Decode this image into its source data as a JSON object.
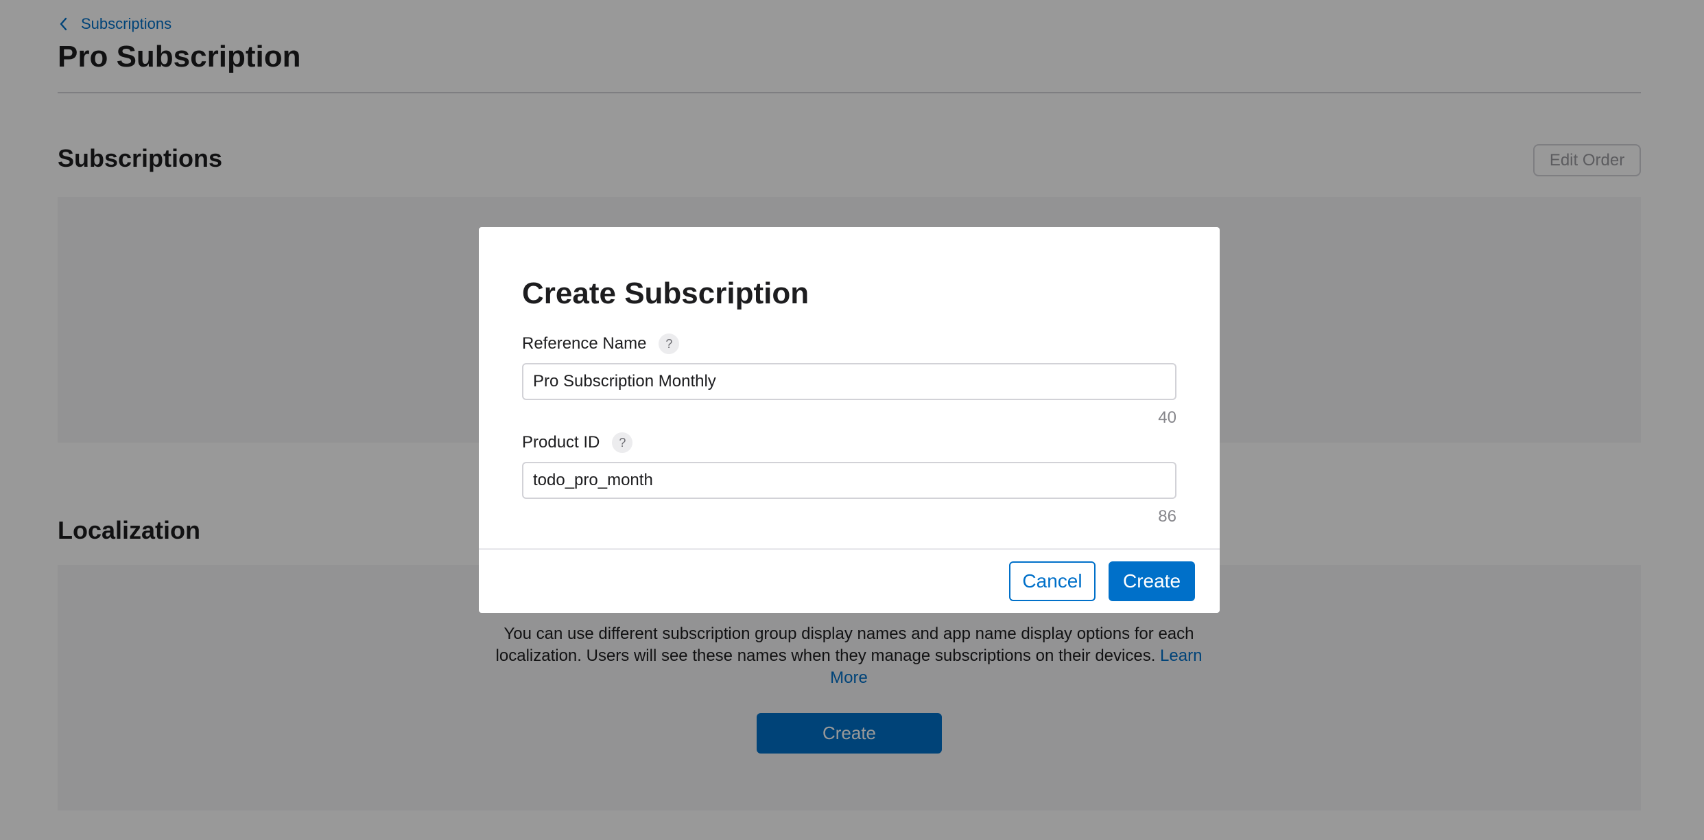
{
  "breadcrumb": {
    "label": "Subscriptions"
  },
  "page": {
    "title": "Pro Subscription"
  },
  "subscriptions_section": {
    "title": "Subscriptions",
    "edit_order_label": "Edit Order"
  },
  "localization_section": {
    "title": "Localization",
    "description": "You can use different subscription group display names and app name display options for each localization. Users will see these names when they manage subscriptions on their devices.",
    "learn_more_label": "Learn More",
    "create_label": "Create"
  },
  "modal": {
    "title": "Create Subscription",
    "reference_name": {
      "label": "Reference Name",
      "help": "?",
      "value": "Pro Subscription Monthly",
      "remaining": "40"
    },
    "product_id": {
      "label": "Product ID",
      "help": "?",
      "value": "todo_pro_month",
      "remaining": "86"
    },
    "cancel_label": "Cancel",
    "create_label": "Create"
  },
  "colors": {
    "accent": "#0070c9",
    "overlay": "rgba(0,0,0,0.40)",
    "panel": "#f5f5f7"
  },
  "icons": {
    "back": "chevron-left-icon",
    "help": "help-icon"
  }
}
